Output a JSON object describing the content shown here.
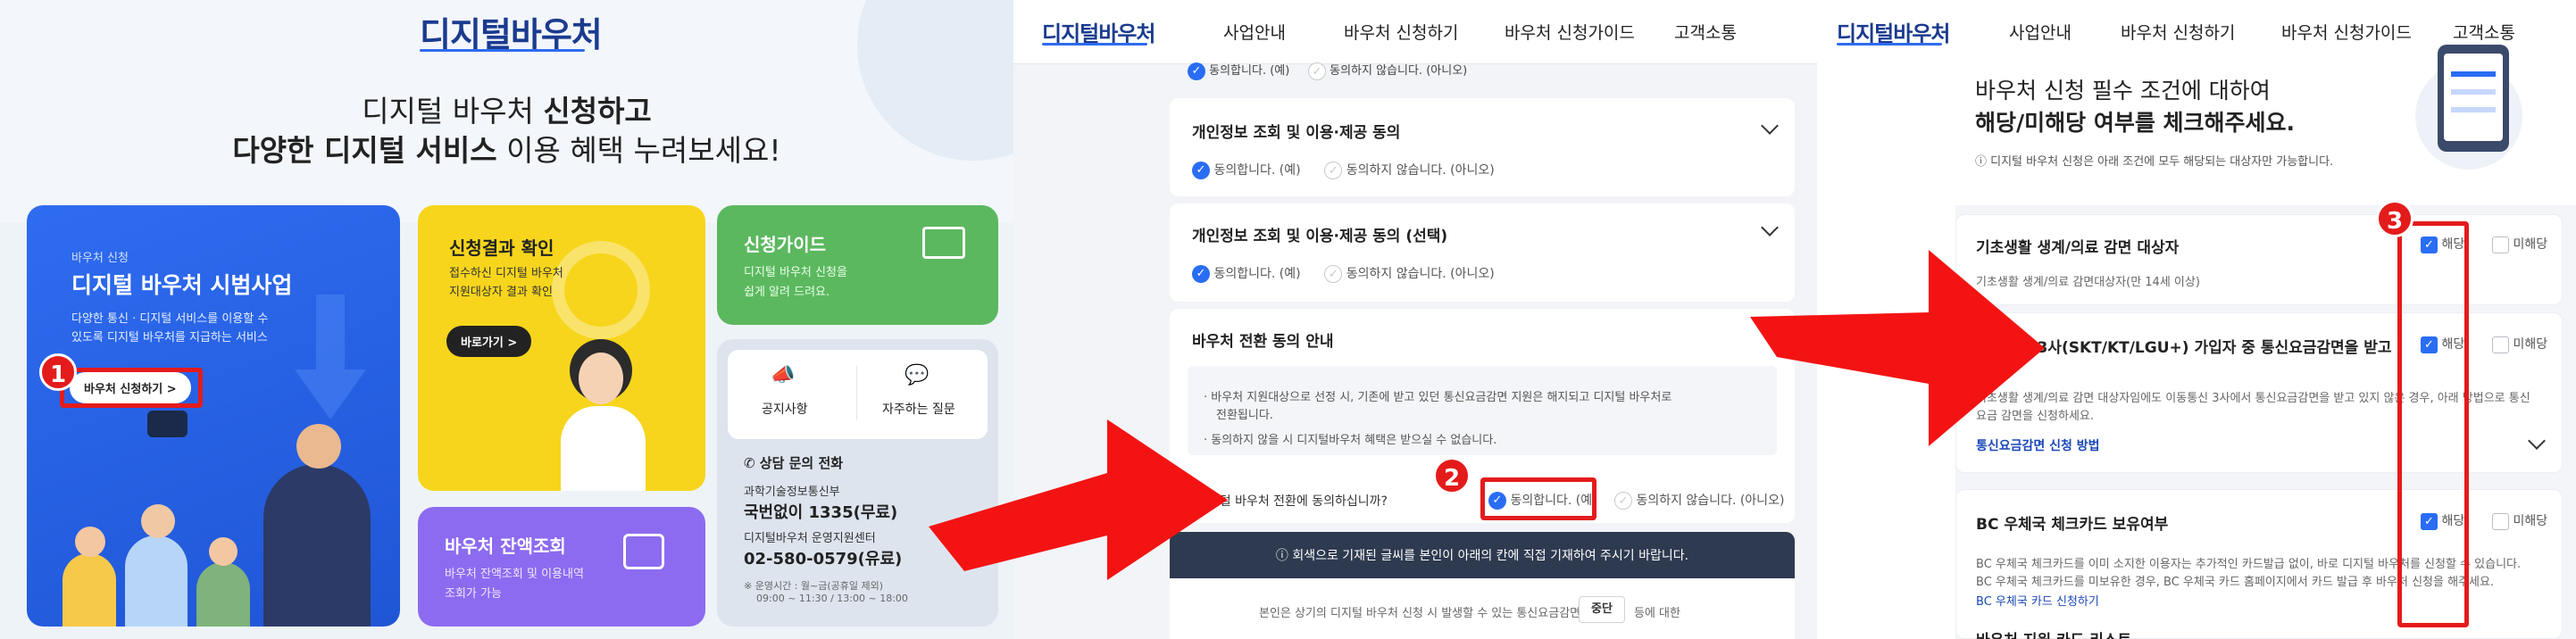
{
  "panel1": {
    "logo": "디지털바우처",
    "hero_line1_pre": "디지털 바우처 ",
    "hero_line1_bold": "신청하고",
    "hero_line2_bold": "다양한 디지털 서비스",
    "hero_line2_post": " 이용 혜택 누려보세요!",
    "main_card": {
      "eyebrow": "바우처 신청",
      "title": "디지털 바우처 시범사업",
      "desc1": "다양한 통신 · 디지털 서비스를 이용할 수",
      "desc2": "있도록 디지털 바우처를 지급하는 서비스",
      "button": "바우처 신청하기 >"
    },
    "result_card": {
      "title": "신청결과 확인",
      "desc1": "접수하신 디지털 바우처",
      "desc2": "지원대상자 결과 확인",
      "button": "바로가기 >"
    },
    "guide_card": {
      "title": "신청가이드",
      "desc1": "디지털 바우처 신청을",
      "desc2": "쉽게 알려 드려요."
    },
    "balance_card": {
      "title": "바우처 잔액조회",
      "desc1": "바우처 잔액조회 및 이용내역",
      "desc2": "조회가 가능"
    },
    "notice_label": "공지사항",
    "faq_label": "자주하는 질문",
    "contact": {
      "title": "상담 문의 전화",
      "org1": "과학기술정보통신부",
      "phone1": "국번없이 1335(무료)",
      "org2": "디지털바우처 운영지원센터",
      "phone2": "02-580-0579(유료)",
      "hours1": "※ 운영시간 : 월~금(공휴일 제외)",
      "hours2": "09:00 ~ 11:30 / 13:00 ~ 18:00"
    },
    "step": "1"
  },
  "nav": {
    "logo": "디지털바우처",
    "items": [
      "사업안내",
      "바우처 신청하기",
      "바우처 신청가이드",
      "고객소통"
    ]
  },
  "panel2": {
    "top_yes": "동의합니다. (예)",
    "top_no": "동의하지 않습니다. (아니오)",
    "section1_title": "개인정보 조회 및 이용·제공 동의",
    "section2_title": "개인정보 조회 및 이용·제공 동의 (선택)",
    "yes": "동의합니다. (예)",
    "no": "동의하지 않습니다. (아니오)",
    "transfer_title": "바우처 전환 동의 안내",
    "bullet1a": "· 바우처 지원대상으로 선정 시, 기존에 받고 있던 통신요금감면 지원은 해지되고 디지털 바우처로",
    "bullet1b": "전환됩니다.",
    "bullet2": "· 동의하지 않을 시 디지털바우처 혜택은 받으실 수 없습니다.",
    "question": "디지털 바우처 전환에 동의하십니까?",
    "banner": "회색으로 기재된 글씨를 본인이 아래의 칸에 직접 기재하여 주시기 바랍니다.",
    "bottom_pre": "본인은 상기의 디지털 바우처 신청 시 발생할 수 있는 통신요금감면",
    "bottom_box": "중단",
    "bottom_post": "등에 대한",
    "step": "2"
  },
  "panel3": {
    "heading1": "바우처 신청 필수 조건에 대하여",
    "heading2": "해당/미해당 여부를 체크해주세요.",
    "note": "디지털 바우처 신청은 아래 조건에 모두 해당되는 대상자만 가능합니다.",
    "yes_label": "해당",
    "no_label": "미해당",
    "cond1_title": "기초생활 생계/의료 감면 대상자",
    "cond1_desc": "기초생활 생계/의료 감면대상자(만 14세 이상)",
    "cond2_title": "이동통신 3사(SKT/KT/LGU+) 가입자 중 통신요금감면을 받고 있는 자",
    "cond2_desc1": "기초생활 생계/의료 감면 대상자임에도 이동통신 3사에서 통신요금감면을 받고 있지 않은 경우, 아래 방법으로 통신",
    "cond2_desc2": "요금 감면을 신청하세요.",
    "cond2_link": "통신요금감면 신청 방법",
    "cond3_title": "BC 우체국 체크카드 보유여부",
    "cond3_desc1": "BC 우체국 체크카드를 이미 소지한 이용자는 추가적인 카드발급 없이, 바로 디지털 바우처를 신청할 수 있습니다.",
    "cond3_desc2": "BC 우체국 체크카드를 미보유한 경우, BC 우체국 카드 홈페이지에서 카드 발급 후 바우처 신청을 해주세요.",
    "cond3_link": "BC 우체국 카드 신청하기",
    "cond4_title": "바우처 지원 카드 리스트",
    "step": "3"
  },
  "colors": {
    "accent_blue": "#2a6df4",
    "red": "#e41b1b",
    "yellow": "#f7d51c",
    "green": "#5cb85f",
    "purple": "#8c6bf0",
    "navy": "#2e3a50"
  }
}
